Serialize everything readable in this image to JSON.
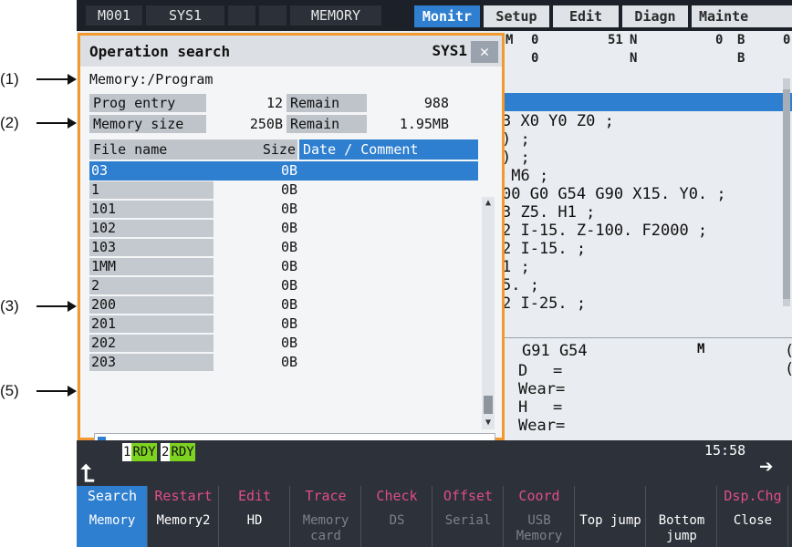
{
  "annotations": [
    "(1)",
    "(2)",
    "(3)",
    "(5)"
  ],
  "topbar": {
    "left": [
      "M001",
      "SYS1",
      "",
      "",
      "MEMORY"
    ],
    "tabs": [
      "Monitr",
      "Setup",
      "Edit",
      "Diagn",
      "Mainte"
    ],
    "active_tab": "Monitr"
  },
  "monitor": {
    "status_row1": [
      "M",
      "0",
      "51",
      "N",
      "0",
      "B",
      "0"
    ],
    "status_row2": [
      "0",
      "N",
      "B"
    ],
    "program_lines": [
      "3 X0 Y0 Z0 ;",
      ") ;",
      ") ;",
      " M6 ;",
      "00 G0 G54 G90 X15. Y0. ;",
      "3 Z5. H1 ;",
      "2 I-15. Z-100. F2000 ;",
      "2 I-15. ;",
      "1 ;",
      "5. ;",
      "2 I-25. ;"
    ],
    "modal": "G91 G54",
    "modal_m": "M",
    "d_label": "D",
    "h_label": "H",
    "equals": "=",
    "wear": "Wear=",
    "right_vals": [
      "(",
      "("
    ]
  },
  "dialog": {
    "title": "Operation search",
    "sys": "SYS1",
    "close_icon": "close-icon",
    "path": "Memory:/Program",
    "prog_entry_label": "Prog entry",
    "prog_entry_value": "12",
    "remain_label": "Remain",
    "prog_remain_value": "988",
    "memory_size_label": "Memory size",
    "memory_size_value": "250B",
    "memory_remain_value": "1.95MB",
    "columns": [
      "File name",
      "Size",
      "Date / Comment"
    ],
    "files": [
      {
        "name": "03",
        "size": "0B"
      },
      {
        "name": "1",
        "size": "0B"
      },
      {
        "name": "101",
        "size": "0B"
      },
      {
        "name": "102",
        "size": "0B"
      },
      {
        "name": "103",
        "size": "0B"
      },
      {
        "name": "1MM",
        "size": "0B"
      },
      {
        "name": "2",
        "size": "0B"
      },
      {
        "name": "200",
        "size": "0B"
      },
      {
        "name": "201",
        "size": "0B"
      },
      {
        "name": "202",
        "size": "0B"
      },
      {
        "name": "203",
        "size": "0B"
      }
    ],
    "selected_index": 0,
    "input_value": ""
  },
  "bottom": {
    "rdy": [
      {
        "num": "1",
        "label": "RDY"
      },
      {
        "num": "2",
        "label": "RDY"
      }
    ],
    "clock": "15:58",
    "menu_up_icon": "menu-up-arrow-icon",
    "menu_next_icon": "menu-next-arrow-icon",
    "fkeys": [
      {
        "top": "Search",
        "bottom": "Memory",
        "active": true,
        "dim": false
      },
      {
        "top": "Restart",
        "bottom": "Memory2",
        "active": false,
        "dim": false
      },
      {
        "top": "Edit",
        "bottom": "HD",
        "active": false,
        "dim": false
      },
      {
        "top": "Trace",
        "bottom": "Memory card",
        "active": false,
        "dim": true
      },
      {
        "top": "Check",
        "bottom": "DS",
        "active": false,
        "dim": true
      },
      {
        "top": "Offset",
        "bottom": "Serial",
        "active": false,
        "dim": true
      },
      {
        "top": "Coord",
        "bottom": "USB Memory",
        "active": false,
        "dim": true
      },
      {
        "top": "",
        "bottom": "Top jump",
        "active": false,
        "dim": false
      },
      {
        "top": "",
        "bottom": "Bottom jump",
        "active": false,
        "dim": false
      },
      {
        "top": "Dsp.Chg",
        "bottom": "Close",
        "active": false,
        "dim": false
      }
    ]
  },
  "colors": {
    "accent": "#2f7fd0",
    "dialog_border": "#f29a2e",
    "rdy_green": "#7ed321",
    "fkey_top": "#e04d8a"
  }
}
